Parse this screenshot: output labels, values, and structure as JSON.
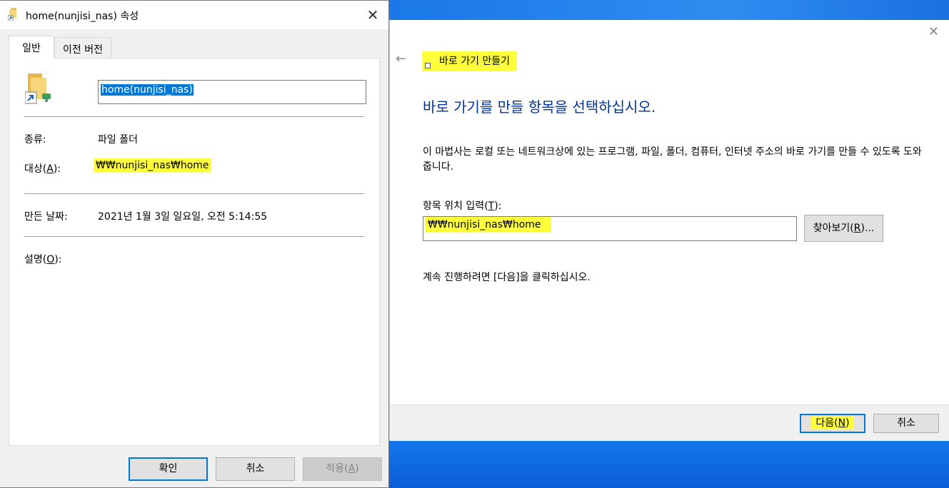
{
  "properties_dialog": {
    "title": "home(nunjisi_nas) 속성",
    "tabs": [
      "일반",
      "이전 버전"
    ],
    "name_value": "home(nunjisi_nas)",
    "type_label": "종류:",
    "type_value": "파일 폴더",
    "target_label": "대상",
    "target_accel": "A",
    "target_value": "₩₩nunjisi_nas₩home",
    "modified_label": "만든 날짜:",
    "modified_value": "2021년 1월 3일 일요일, 오전 5:14:55",
    "comment_label": "설명",
    "comment_accel": "O",
    "buttons": {
      "ok": "확인",
      "cancel": "취소",
      "apply": "적용",
      "apply_accel": "A"
    }
  },
  "wizard": {
    "title": "바로 가기 만들기",
    "heading": "바로 가기를 만들 항목을 선택하십시오.",
    "description": "이 마법사는 로컬 또는 네트워크상에 있는 프로그램, 파일, 폴더, 컴퓨터, 인터넷 주소의 바로 가기를 만들 수 있도록 도와줍니다.",
    "location_label": "항목 위치 입력",
    "location_accel": "T",
    "location_value": "₩₩nunjisi_nas₩home",
    "browse_label": "찾아보기",
    "browse_accel": "R",
    "continue_text": "계속 진행하려면 [다음]을 클릭하십시오.",
    "next_label": "다음",
    "next_accel": "N",
    "cancel_label": "취소"
  },
  "colors": {
    "highlight": "#ffff3c",
    "selection": "#0078d7",
    "heading": "#003399"
  },
  "icons": [
    "folder-shortcut-icon",
    "close-icon",
    "back-arrow-icon",
    "shortcut-icon"
  ]
}
